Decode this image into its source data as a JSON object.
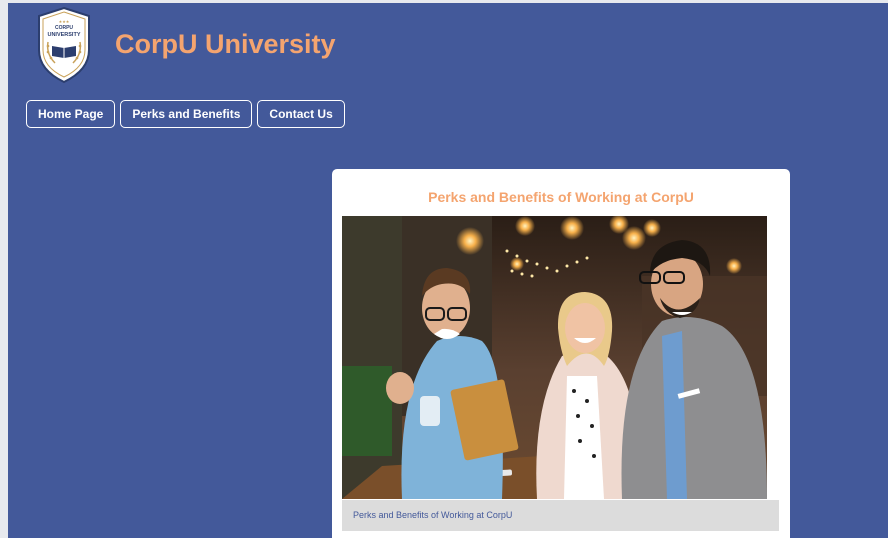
{
  "site": {
    "title": "CorpU University",
    "logo_icon": "university-shield-icon",
    "logo_text_top": "CORPU",
    "logo_text_main": "UNIVERSITY"
  },
  "nav": {
    "items": [
      {
        "label": "Home Page"
      },
      {
        "label": "Perks and Benefits"
      },
      {
        "label": "Contact Us"
      }
    ]
  },
  "main": {
    "card_title": "Perks and Benefits of Working at CorpU",
    "image_alt": "Three coworkers smiling and looking at a tablet in a cafe",
    "caption": "Perks and Benefits of Working at CorpU"
  },
  "colors": {
    "background": "#43599a",
    "accent": "#f4a46f",
    "card": "#ffffff",
    "caption_bg": "#dcdcdc"
  }
}
